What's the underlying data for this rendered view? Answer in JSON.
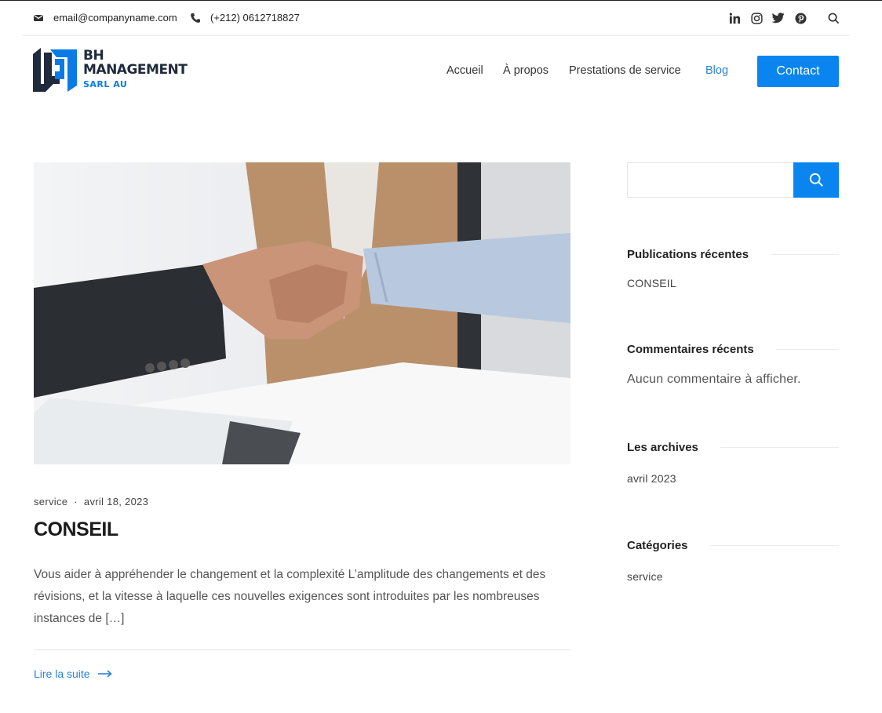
{
  "topbar": {
    "email": "email@companyname.com",
    "phone": "(+212) 0612718827",
    "social_icons": [
      "linkedin-icon",
      "instagram-icon",
      "twitter-icon",
      "pinterest-icon",
      "search-icon"
    ]
  },
  "brand": {
    "line1": "BH",
    "line2": "MANAGEMENT",
    "line3": "SARL AU",
    "dark_color": "#1f2a3c",
    "accent_color": "#0a7be6"
  },
  "nav": {
    "items": [
      "Accueil",
      "À propos",
      "Prestations de service",
      "Blog"
    ],
    "active": "Blog",
    "contact_label": "Contact"
  },
  "post": {
    "category": "service",
    "date": "avril 18, 2023",
    "title": "CONSEIL",
    "excerpt": "Vous aider à appréhender le changement et la complexité L’amplitude des changements et des révisions, et la vitesse à laquelle ces nouvelles exigences sont introduites par les nombreuses instances de […]",
    "read_more": "Lire la suite"
  },
  "sidebar": {
    "search_placeholder": "",
    "recent_posts": {
      "title": "Publications récentes",
      "items": [
        "CONSEIL"
      ]
    },
    "recent_comments": {
      "title": "Commentaires récents",
      "empty": "Aucun commentaire à afficher."
    },
    "archives": {
      "title": "Les archives",
      "items": [
        "avril 2023"
      ]
    },
    "categories": {
      "title": "Catégories",
      "items": [
        "service"
      ]
    }
  },
  "colors": {
    "primary": "#0a84ee",
    "link": "#2a82d7"
  }
}
